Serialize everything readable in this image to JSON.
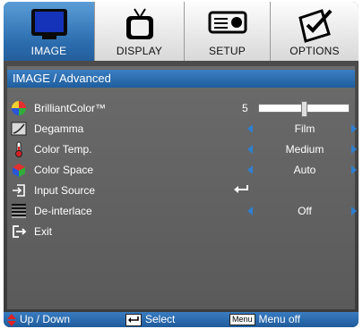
{
  "tabs": [
    {
      "label": "IMAGE",
      "icon": "monitor-icon",
      "active": true
    },
    {
      "label": "DISPLAY",
      "icon": "tv-icon",
      "active": false
    },
    {
      "label": "SETUP",
      "icon": "projector-icon",
      "active": false
    },
    {
      "label": "OPTIONS",
      "icon": "pencil-paper-icon",
      "active": false
    }
  ],
  "header": {
    "title": "IMAGE / Advanced"
  },
  "rows": {
    "brilliantcolor": {
      "label": "BrilliantColor™",
      "value": "5",
      "slider_fraction": 0.5
    },
    "degamma": {
      "label": "Degamma",
      "value": "Film"
    },
    "color_temp": {
      "label": "Color Temp.",
      "value": "Medium"
    },
    "color_space": {
      "label": "Color Space",
      "value": "Auto"
    },
    "input_source": {
      "label": "Input Source"
    },
    "deinterlace": {
      "label": "De-interlace",
      "value": "Off"
    },
    "exit": {
      "label": "Exit"
    }
  },
  "footer": {
    "up_down": "Up / Down",
    "select": "Select",
    "menu_key": "Menu",
    "menu_off": "Menu off"
  },
  "colors": {
    "accent": "#2f7fcf",
    "header": "#1f5e9d",
    "panel": "#616161"
  }
}
